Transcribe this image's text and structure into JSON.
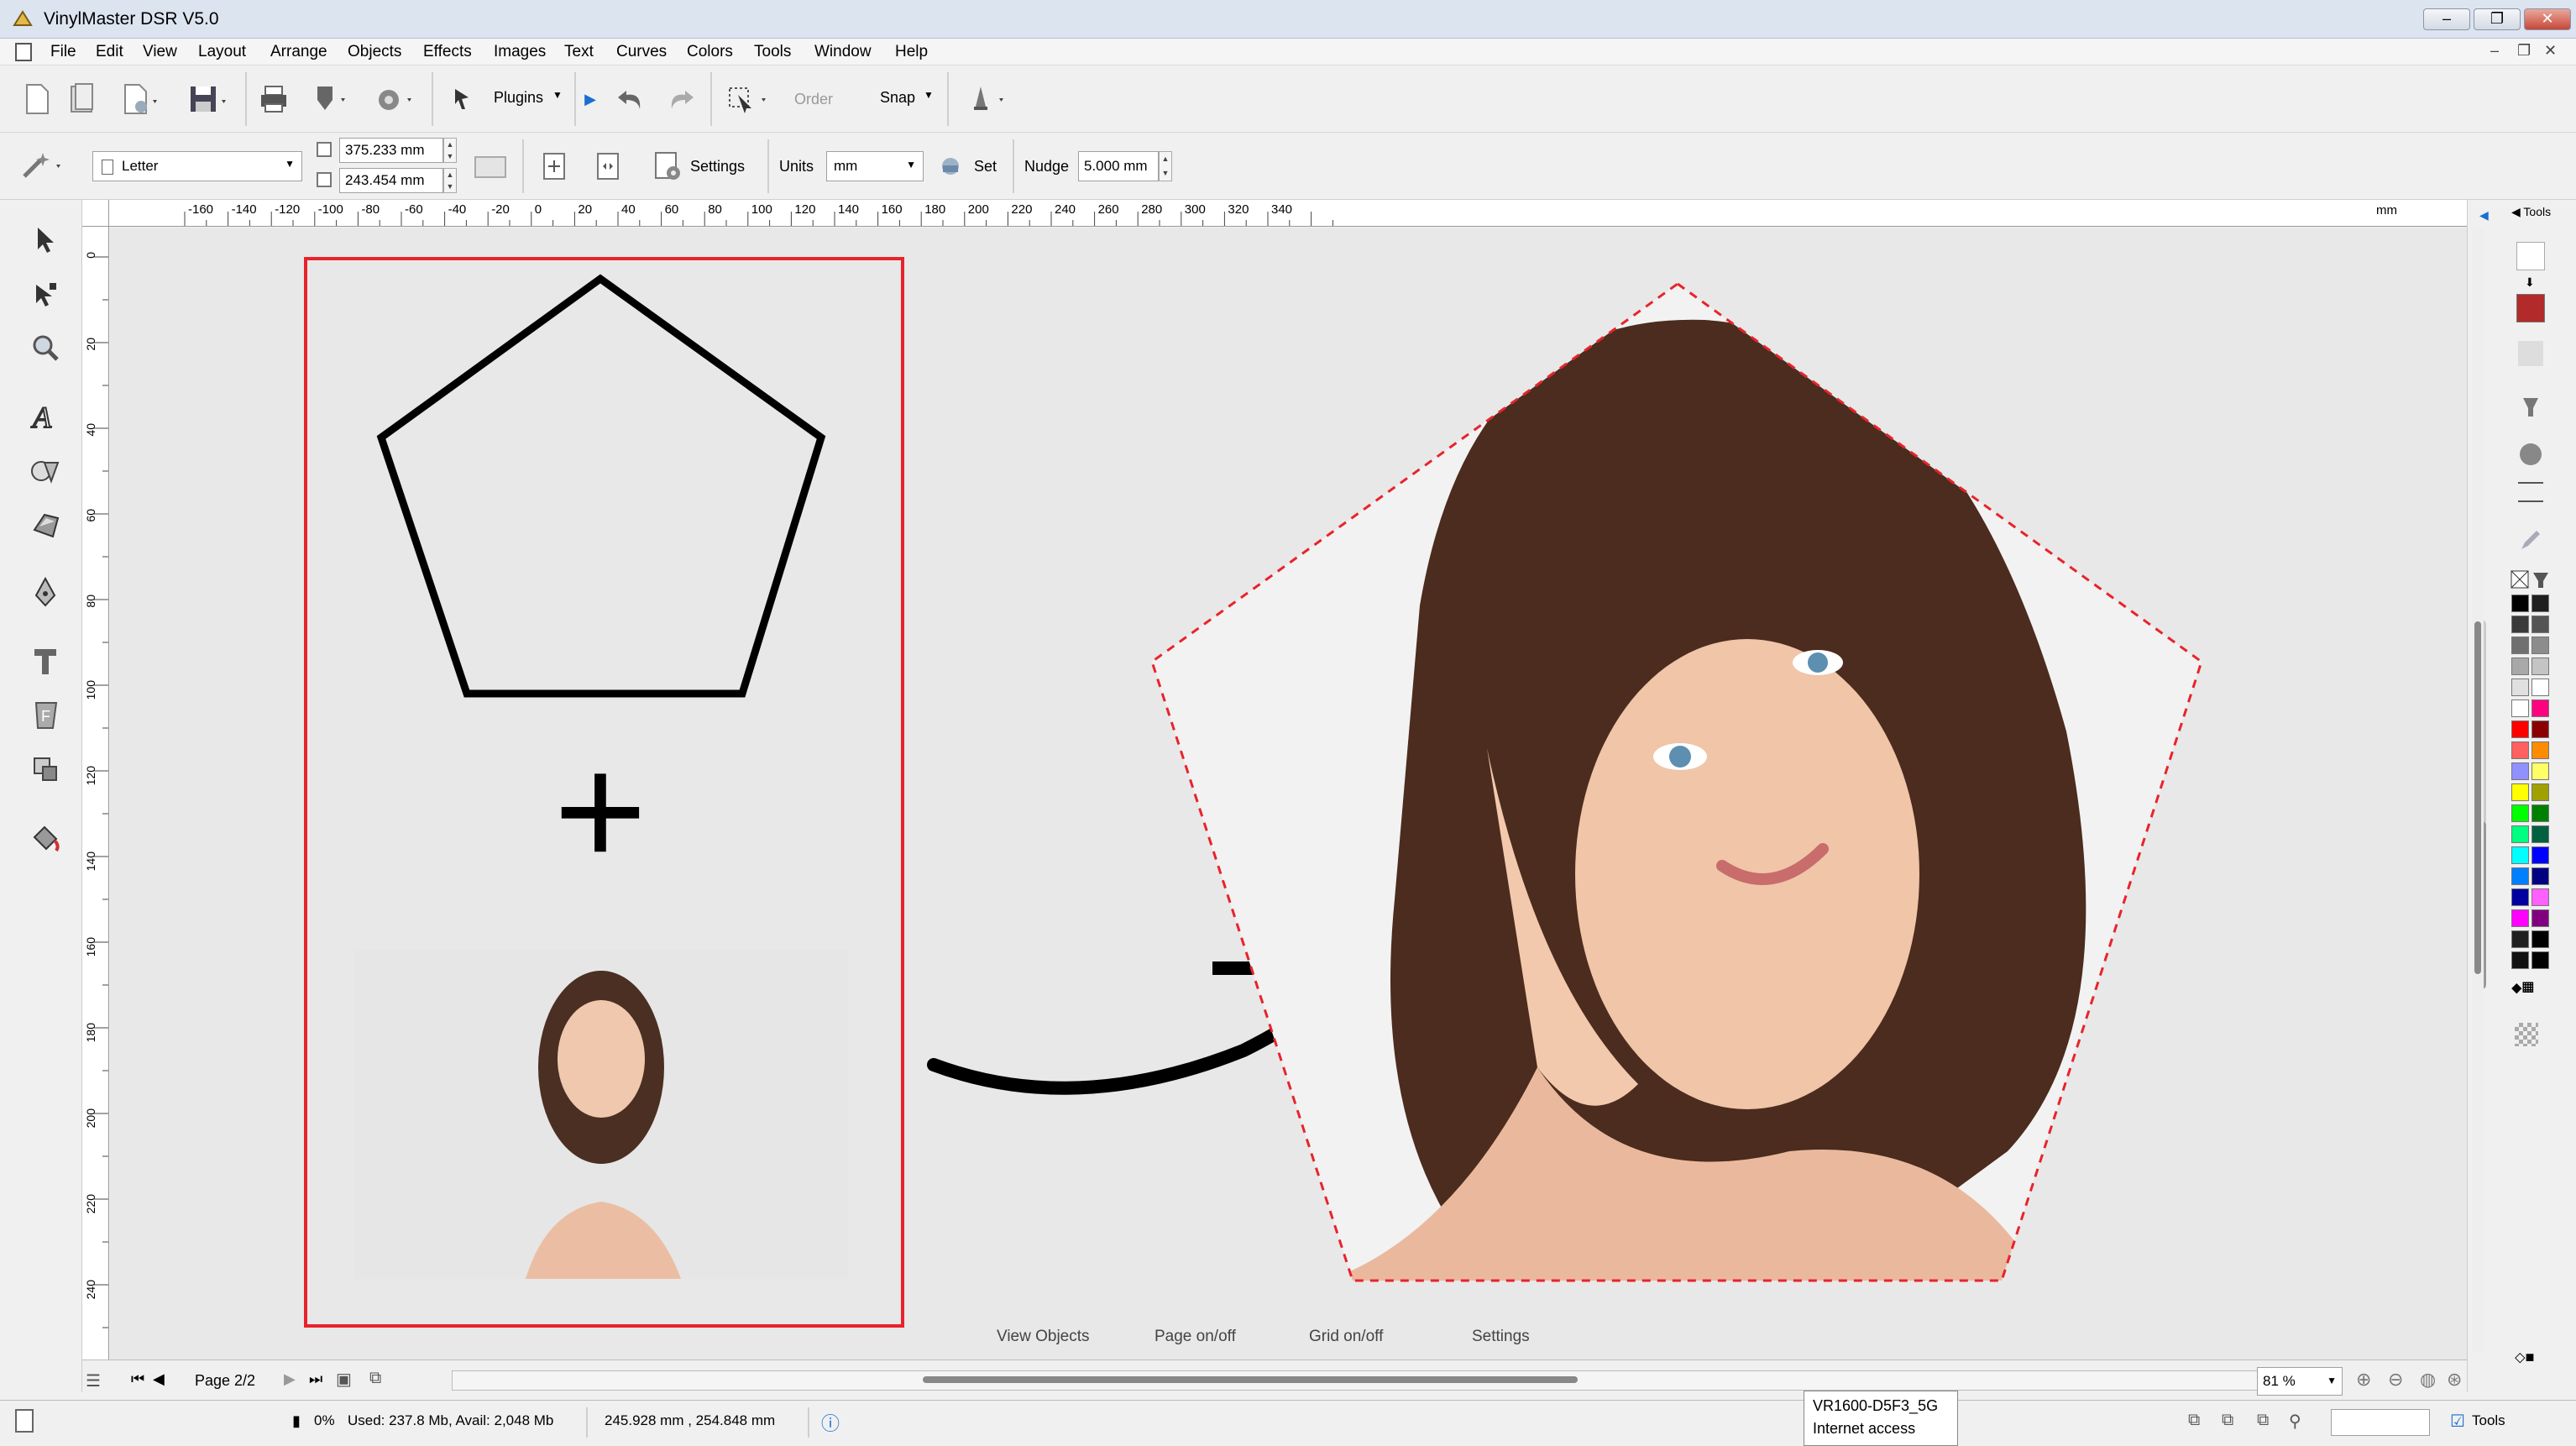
{
  "window": {
    "title": "VinylMaster DSR V5.0"
  },
  "menu": [
    "File",
    "Edit",
    "View",
    "Layout",
    "Arrange",
    "Objects",
    "Effects",
    "Images",
    "Text",
    "Curves",
    "Colors",
    "Tools",
    "Window",
    "Help"
  ],
  "toolbar": {
    "plugins_label": "Plugins",
    "order_label": "Order",
    "snap_label": "Snap"
  },
  "properties": {
    "page_size": "Letter",
    "width": "375.233 mm",
    "height": "243.454 mm",
    "settings_label": "Settings",
    "units_label": "Units",
    "units_value": "mm",
    "set_label": "Set",
    "nudge_label": "Nudge",
    "nudge_value": "5.000 mm"
  },
  "ruler": {
    "h_ticks": [
      "-160",
      "-140",
      "-120",
      "-100",
      "-80",
      "-60",
      "-40",
      "-20",
      "0",
      "20",
      "40",
      "60",
      "80",
      "100",
      "120",
      "140",
      "160",
      "180",
      "200",
      "220",
      "240",
      "260",
      "280",
      "300",
      "320",
      "340"
    ],
    "h_unit": "mm",
    "v_ticks": [
      "0",
      "20",
      "40",
      "60",
      "80",
      "100",
      "120",
      "140",
      "160",
      "180",
      "200",
      "220",
      "240"
    ]
  },
  "canvas": {
    "plus_sign": "+",
    "labels": {
      "view_objects": "View Objects",
      "page_toggle": "Page on/off",
      "grid_toggle": "Grid on/off",
      "settings": "Settings"
    }
  },
  "bottom": {
    "page_label": "Page 2/2",
    "zoom": "81 %"
  },
  "status": {
    "progress": "0%",
    "memory": "Used: 237.8 Mb, Avail: 2,048 Mb",
    "coords": "245.928 mm , 254.848 mm",
    "tools_label": "Tools"
  },
  "right_panel": {
    "tools_label": "Tools"
  },
  "tooltip": {
    "line1": "VR1600-D5F3_5G",
    "line2": "Internet access"
  },
  "palette": [
    "#000000",
    "#1f1f1f",
    "#3a3a3a",
    "#555555",
    "#707070",
    "#8c8c8c",
    "#a8a8a8",
    "#c4c4c4",
    "#e0e0e0",
    "#ffffff",
    "#ffffff",
    "#ff007f",
    "#ff0000",
    "#8b0000",
    "#ff6060",
    "#ff8c00",
    "#9090ff",
    "#ffff66",
    "#ffff00",
    "#a0a000",
    "#00ff00",
    "#008000",
    "#00ff80",
    "#006040",
    "#00ffff",
    "#0000ff",
    "#0080ff",
    "#000080",
    "#0000a0",
    "#ff60ff",
    "#ff00ff",
    "#800080",
    "#202020",
    "#000000",
    "#101010",
    "#000000"
  ]
}
